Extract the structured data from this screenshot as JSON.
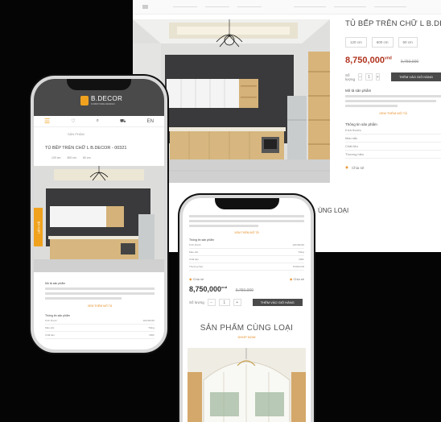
{
  "product": {
    "title": "TỦ BẾP TRÊN CHỮ L B.DECOR",
    "mobile_title": "TỦ BẾP TRÊN CHỮ L B.DECOR - 00321",
    "sizes": [
      "120 cm",
      "600 cm",
      "60 cm"
    ],
    "price": "8,750,000",
    "currency": "vnd",
    "old_price": "9,750,000",
    "qty_label": "Số lượng",
    "qty_minus": "−",
    "qty_value": "1",
    "qty_plus": "+",
    "buy_label": "THÊM VÀO GIỎ HÀNG",
    "desc_title": "Mô tả sản phẩm",
    "read_more": "XEM THÊM MÔ TẢ",
    "spec_title": "Thông tin sản phẩm",
    "specs": [
      {
        "name": "Kích thước",
        "value": "120x60x60"
      },
      {
        "name": "Màu sắc",
        "value": "Trắng"
      },
      {
        "name": "Chất liệu",
        "value": "MDF"
      },
      {
        "name": "Thương hiệu",
        "value": "B.DECOR"
      }
    ],
    "share": "Chia sẻ"
  },
  "related": {
    "title": "SẢN PHẨM CÙNG LOẠI",
    "desktop_partial": "ÙNG LOẠI",
    "link": "SHOP NOW"
  },
  "mobile": {
    "brand": "B.DECOR",
    "brand_sub": "FURNITURE DESIGN",
    "lang": "EN",
    "breadcrumb": "SẢN PHẨM",
    "side_tab": "LIÊN HỆ"
  },
  "colors": {
    "accent": "#f0a21e",
    "header": "#4a4a4a",
    "price": "#b0341f"
  },
  "icons": [
    "menu-icon",
    "heart-icon",
    "search-icon",
    "cart-icon",
    "chandelier-icon"
  ]
}
